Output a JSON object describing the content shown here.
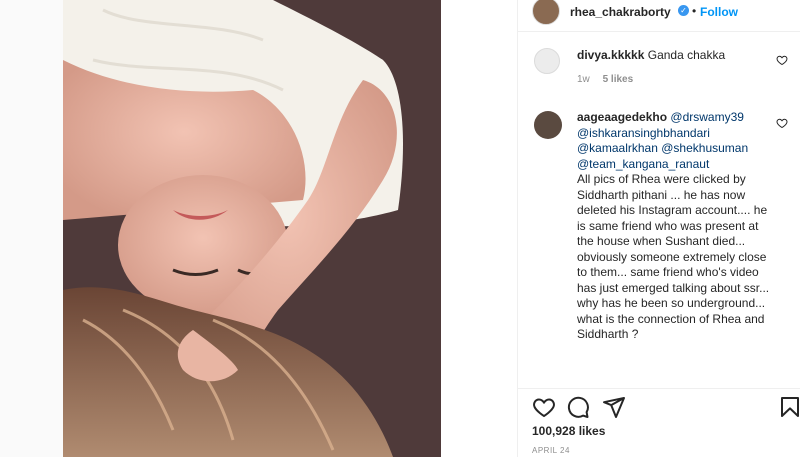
{
  "post": {
    "username": "rhea_chakraborty",
    "verified_mark": "✓",
    "separator": "•",
    "follow_label": "Follow"
  },
  "comments": [
    {
      "username": "divya.kkkkk",
      "text": "Ganda chakka",
      "time": "1w",
      "likes": "5 likes",
      "mentions": [],
      "body": ""
    },
    {
      "username": "aageaagedekho",
      "mentions": [
        "@drswamy39",
        "@ishkaransinghbhandari",
        "@kamaalrkhan",
        "@shekhusuman",
        "@team_kangana_ranaut"
      ],
      "body": "All pics of Rhea were clicked by Siddharth pithani ... he has now deleted his Instagram account.... he is same friend who was present at the house when Sushant died... obviously someone extremely close to them... same friend who's video has just emerged talking about ssr... why has he been so underground... what is the connection of Rhea and Siddharth ?"
    }
  ],
  "footer": {
    "likes": "100,928 likes",
    "date": "APRIL 24"
  },
  "icons": {
    "like": "heart-icon",
    "comment": "comment-icon",
    "share": "share-icon",
    "save": "bookmark-icon"
  },
  "colors": {
    "accent": "#0095f6",
    "verified": "#3897f0",
    "muted": "#8e8e8e"
  }
}
